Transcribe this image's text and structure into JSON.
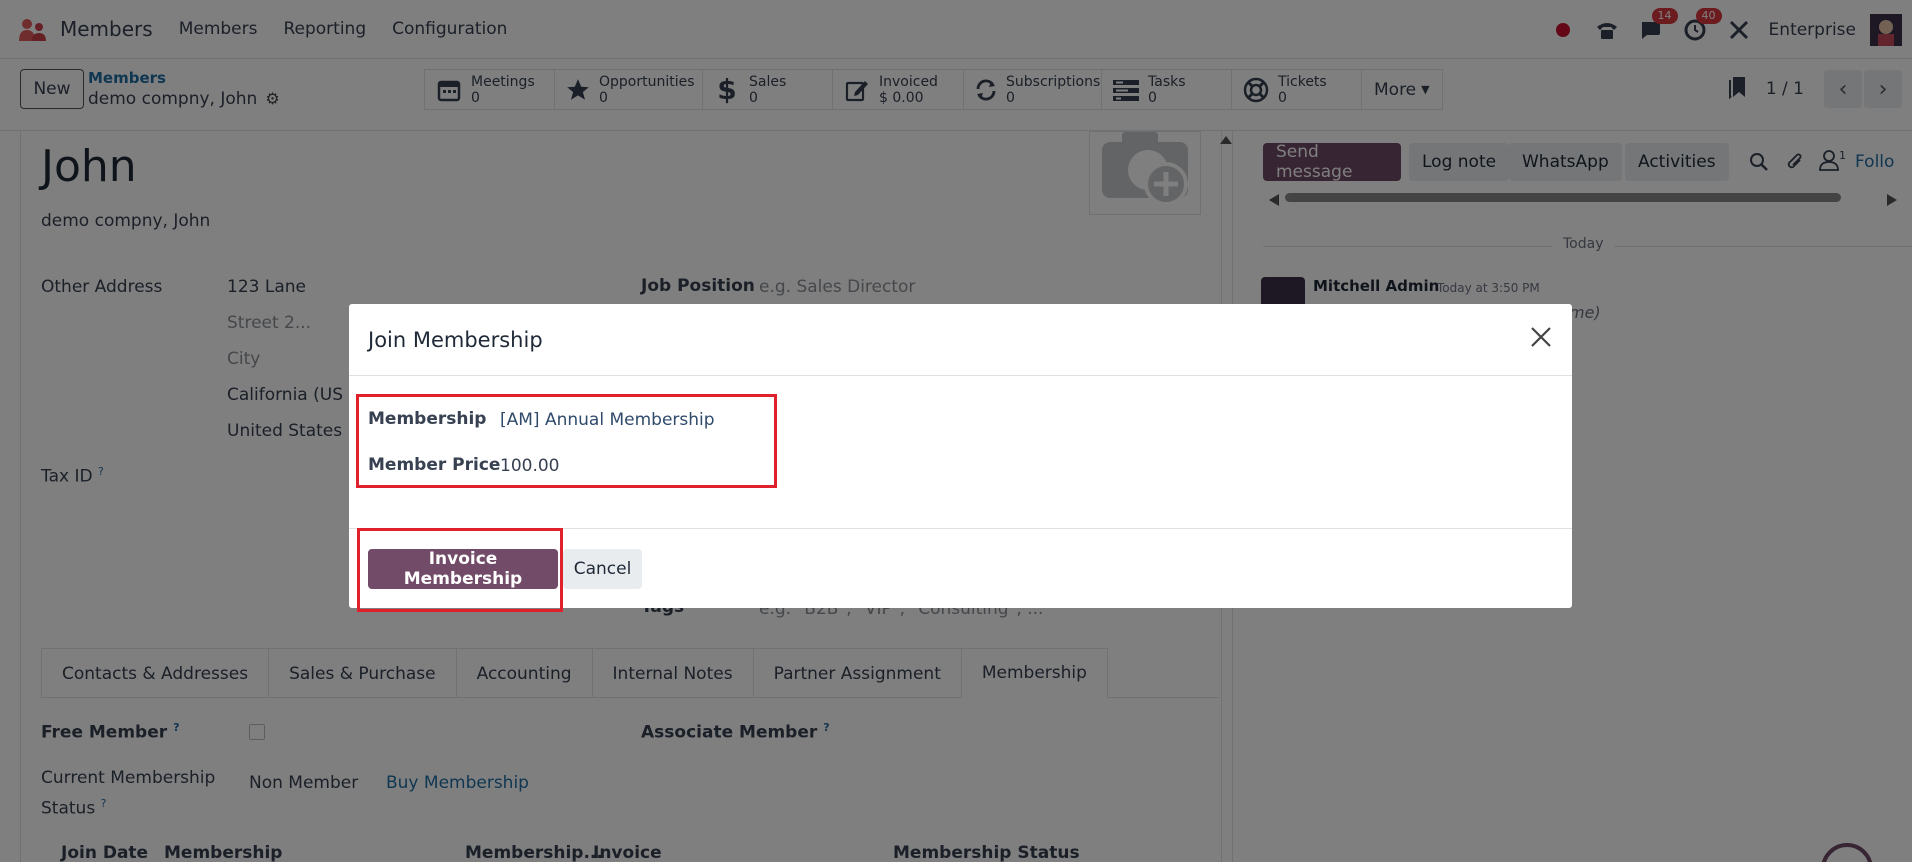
{
  "app": {
    "name": "Members",
    "menu": [
      "Members",
      "Reporting",
      "Configuration"
    ],
    "badges": {
      "messages": "14",
      "activities": "40"
    },
    "company": "Enterprise"
  },
  "control": {
    "new_label": "New",
    "breadcrumb": "Members",
    "record_name": "demo compny, John",
    "smart_buttons": [
      {
        "label": "Meetings",
        "value": "0",
        "icon": "calendar-icon"
      },
      {
        "label": "Opportunities",
        "value": "0",
        "icon": "star-icon"
      },
      {
        "label": "Sales",
        "value": "0",
        "icon": "dollar-icon"
      },
      {
        "label": "Invoiced",
        "value": "$ 0.00",
        "icon": "edit-icon"
      },
      {
        "label": "Subscriptions",
        "value": "0",
        "icon": "refresh-icon"
      },
      {
        "label": "Tasks",
        "value": "0",
        "icon": "tasks-icon"
      },
      {
        "label": "Tickets",
        "value": "0",
        "icon": "lifebuoy-icon"
      }
    ],
    "more_label": "More",
    "pager": "1 / 1"
  },
  "form": {
    "name": "John",
    "company_line": "demo compny, John",
    "address_label": "Other Address",
    "street": "123 Lane",
    "street2_placeholder": "Street 2...",
    "city_placeholder": "City",
    "state": "California (US",
    "country": "United States",
    "job_label": "Job Position",
    "job_placeholder": "e.g. Sales Director",
    "tax_label": "Tax ID",
    "tags_label": "Tags",
    "tags_placeholder": "e.g. \"B2B\", \"VIP\", \"Consulting\", ...",
    "tabs": [
      "Contacts & Addresses",
      "Sales & Purchase",
      "Accounting",
      "Internal Notes",
      "Partner Assignment",
      "Membership"
    ],
    "free_member_label": "Free Member",
    "associate_label": "Associate Member",
    "status_label_1": "Current Membership",
    "status_label_2": "Status",
    "status_value": "Non Member",
    "buy_link": "Buy Membership",
    "columns": [
      "Join Date",
      "Membership",
      "Membership...",
      "Invoice",
      "Membership Status"
    ]
  },
  "chatter": {
    "send_message": "Send message",
    "log_note": "Log note",
    "whatsapp": "WhatsApp",
    "activities": "Activities",
    "followers_count": "1",
    "follow": "Follo",
    "today": "Today",
    "author": "Mitchell Admin",
    "time": "Today at 3:50 PM",
    "snippet": "me)"
  },
  "modal": {
    "title": "Join Membership",
    "membership_label": "Membership",
    "membership_value": "[AM] Annual Membership",
    "price_label": "Member Price",
    "price_value": "100.00",
    "invoice_button": "Invoice Membership",
    "cancel_button": "Cancel"
  },
  "colors": {
    "primary": "#714b67",
    "highlight": "#e0202a",
    "link": "#1f6fa5"
  }
}
